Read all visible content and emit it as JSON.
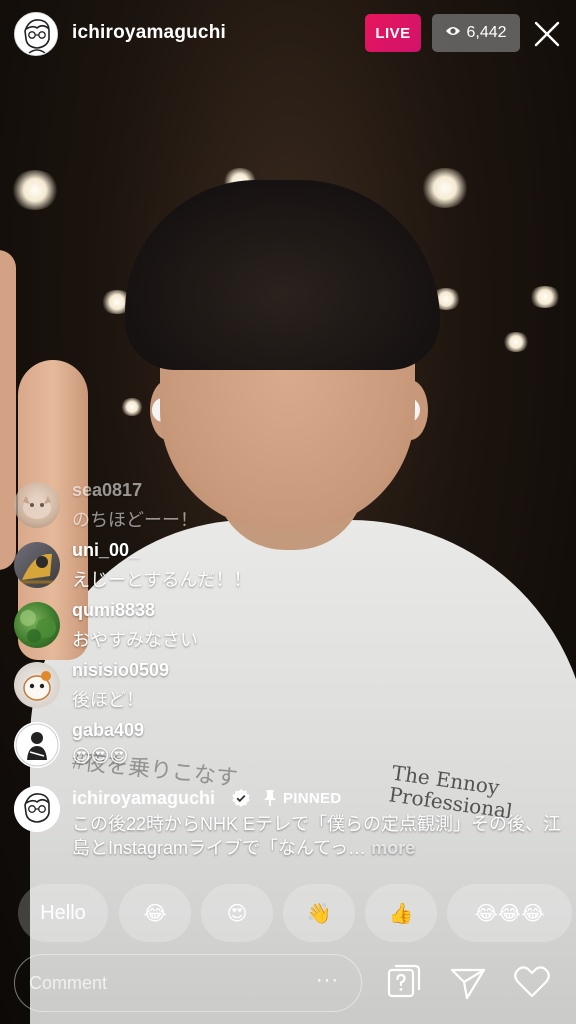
{
  "host": {
    "username": "ichiroyamaguchi",
    "live_label": "LIVE",
    "viewer_count": "6,442"
  },
  "comments": [
    {
      "username": "sea0817",
      "text": "のちほどーー！",
      "faded": true
    },
    {
      "username": "uni_00_",
      "text": "えじーとするんだ！！"
    },
    {
      "username": "qumi8838",
      "text": "おやすみなさい"
    },
    {
      "username": "nisisio0509",
      "text": "後ほど！"
    },
    {
      "username": "gaba409",
      "text": "😍😍😍"
    }
  ],
  "pinned": {
    "username": "ichiroyamaguchi",
    "label": "PINNED",
    "text": "この後22時からNHK Eテレで「僕らの定点観測」その後、江島とInstagramライブで「なんてっ…",
    "more": "more"
  },
  "reactions": [
    "Hello",
    "😂",
    "😍",
    "👋",
    "👍",
    "😂😂😂"
  ],
  "composer": {
    "placeholder": "Comment",
    "more_dots": "···"
  },
  "shirt_text": {
    "line1": "The Ennoy",
    "line2": "Professional",
    "jp": "#夜を乗りこなす"
  },
  "colors": {
    "live": "#e6175c",
    "verified": "#3897f0"
  }
}
